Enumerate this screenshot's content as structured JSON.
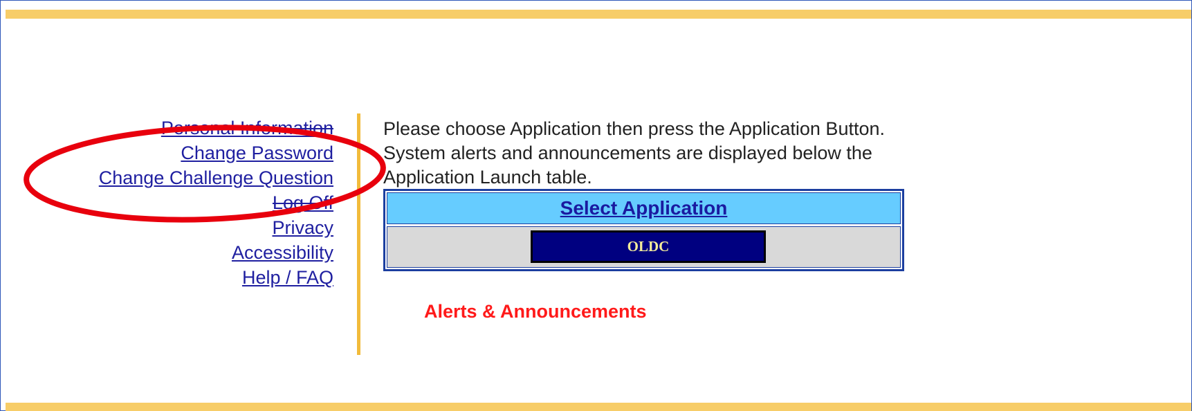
{
  "nav": {
    "items": [
      {
        "label": "Personal Information"
      },
      {
        "label": "Change Password"
      },
      {
        "label": "Change Challenge Question"
      },
      {
        "label": "Log Off"
      },
      {
        "label": "Privacy"
      },
      {
        "label": "Accessibility"
      },
      {
        "label": "Help / FAQ"
      }
    ]
  },
  "instructions": {
    "line1": "Please choose Application then press the Application Button.",
    "line2": "System alerts and announcements are displayed below the",
    "line3": "Application Launch table."
  },
  "app_table": {
    "header": "Select Application",
    "button": "OLDC"
  },
  "alerts": {
    "title": "Alerts & Announcements"
  },
  "colors": {
    "band": "#f7cd68",
    "divider": "#f2bb3b",
    "link": "#1f1fa0",
    "table_header_bg": "#66ccff",
    "button_bg": "#000080",
    "button_text": "#f3ec9a",
    "alerts_text": "#ff1a1a",
    "annotation": "#e8000d"
  },
  "annotation": {
    "shape": "ellipse-highlight",
    "encircles": "Change Password, Change Challenge Question"
  }
}
